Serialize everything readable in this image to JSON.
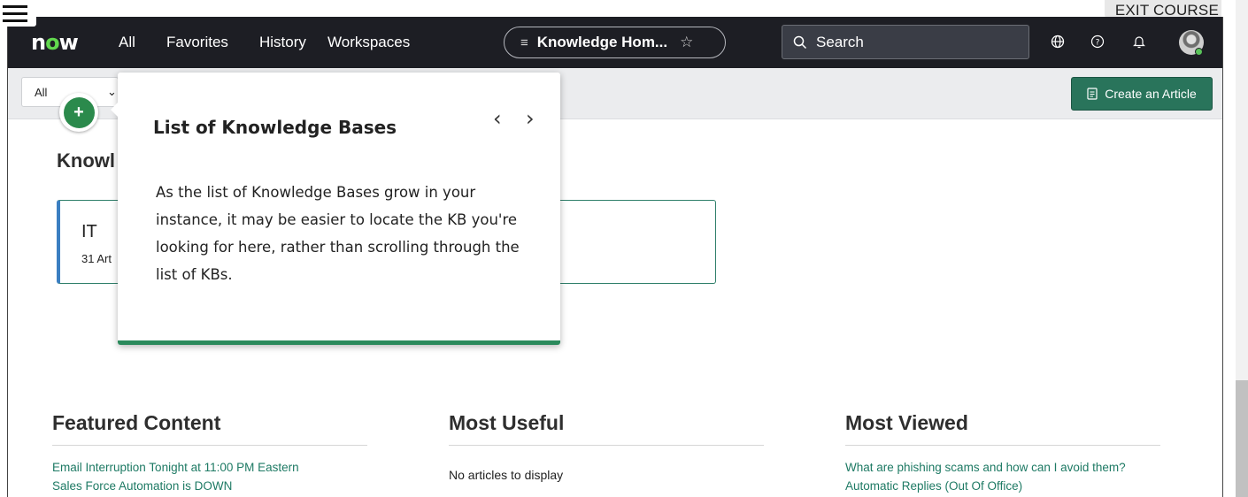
{
  "course": {
    "exit_label": "EXIT COURSE"
  },
  "navbar": {
    "logo": "now",
    "items": [
      "All",
      "Favorites",
      "History",
      "Workspaces"
    ],
    "context_pill": "Knowledge Hom...",
    "search_placeholder": "Search",
    "icons": [
      "globe-icon",
      "help-icon",
      "bell-icon",
      "avatar"
    ]
  },
  "subbar": {
    "filter_value": "All",
    "create_button": "Create an Article"
  },
  "main": {
    "kb_heading": "Knowl",
    "kb_card": {
      "name": "IT",
      "count": "31 Art"
    }
  },
  "popover": {
    "title": "List of Knowledge Bases",
    "body": "As the list of Knowledge Bases grow in your instance, it may be easier to locate the KB you're looking for here, rather than scrolling through the list of KBs."
  },
  "sections": {
    "featured": {
      "title": "Featured Content",
      "links": [
        "Email Interruption Tonight at 11:00 PM Eastern",
        "Sales Force Automation is DOWN"
      ]
    },
    "useful": {
      "title": "Most Useful",
      "empty": "No articles to display"
    },
    "viewed": {
      "title": "Most Viewed",
      "links": [
        "What are phishing scams and how can I avoid them?",
        "Automatic Replies (Out Of Office)"
      ]
    }
  },
  "colors": {
    "navbar": "#1d1e24",
    "accent_green": "#29745b",
    "link": "#1e7a64",
    "logo_o": "#62d84e"
  }
}
